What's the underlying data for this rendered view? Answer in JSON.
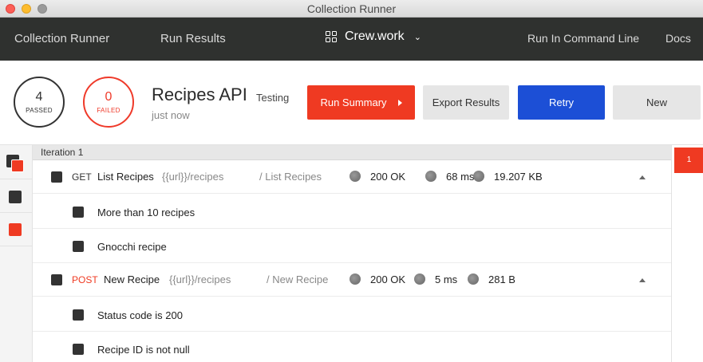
{
  "window": {
    "title": "Collection Runner"
  },
  "nav": {
    "runner_label": "Collection Runner",
    "results_label": "Run Results",
    "workspace": "Crew.work",
    "cli_label": "Run In Command Line",
    "docs_label": "Docs"
  },
  "summary": {
    "passed_count": "4",
    "passed_label": "PASSED",
    "failed_count": "0",
    "failed_label": "FAILED",
    "collection_name": "Recipes API",
    "environment": "Testing",
    "timestamp": "just now",
    "buttons": {
      "run_summary": "Run Summary",
      "export": "Export Results",
      "retry": "Retry",
      "new": "New"
    }
  },
  "iteration": {
    "label": "Iteration 1",
    "requests": [
      {
        "method": "GET",
        "name": "List Recipes",
        "url": "{{url}}/recipes",
        "path": "/ List Recipes",
        "status": "200 OK",
        "time": "68 ms",
        "size": "19.207 KB",
        "tests": [
          "More than 10 recipes",
          "Gnocchi recipe"
        ]
      },
      {
        "method": "POST",
        "name": "New Recipe",
        "url": "{{url}}/recipes",
        "path": "/ New Recipe",
        "status": "200 OK",
        "time": "5 ms",
        "size": "281 B",
        "tests": [
          "Status code is 200",
          "Recipe ID is not null"
        ]
      }
    ]
  },
  "right_pane": {
    "badge": "1"
  },
  "colors": {
    "accent_red": "#ef3a22",
    "retry_blue": "#1c4fd6",
    "nav_dark": "#2f312f"
  },
  "icons": [
    "workspace-grid-icon",
    "chevron-down-icon",
    "play-triangle-icon",
    "status-dot-icon",
    "collapse-arrow-icon"
  ]
}
